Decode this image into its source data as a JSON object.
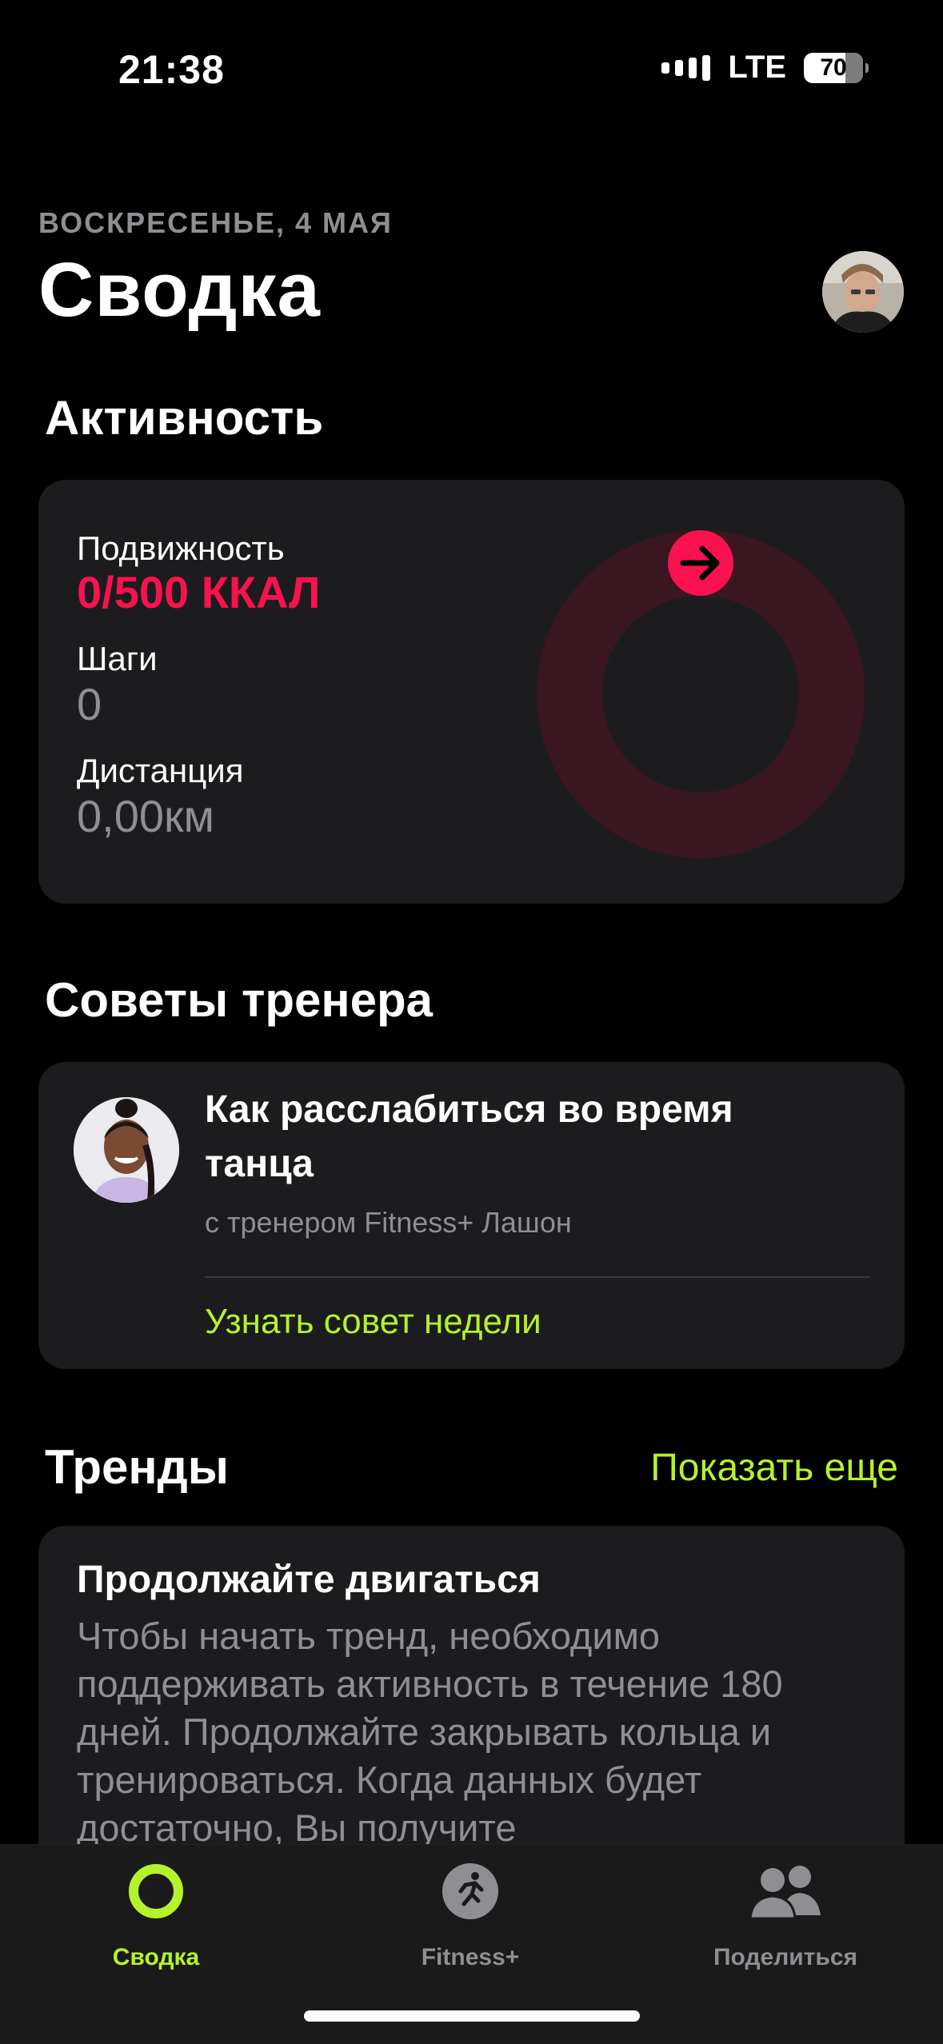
{
  "status_bar": {
    "time": "21:38",
    "network": "LTE",
    "battery": "70"
  },
  "header": {
    "date": "ВОСКРЕСЕНЬЕ, 4 МАЯ",
    "title": "Сводка"
  },
  "activity": {
    "section_title": "Активность",
    "move_label": "Подвижность",
    "move_value": "0/500 ККАЛ",
    "steps_label": "Шаги",
    "steps_value": "0",
    "distance_label": "Дистанция",
    "distance_value": "0,00км",
    "ring_progress": 0,
    "ring_color": "#fa114f",
    "ring_track_color": "#3a1620"
  },
  "coach": {
    "section_title": "Советы тренера",
    "title": "Как расслабиться во время танца",
    "subtitle": "с тренером Fitness+ Лашон",
    "link": "Узнать совет недели"
  },
  "trends": {
    "section_title": "Тренды",
    "show_more": "Показать еще",
    "card_title": "Продолжайте двигаться",
    "card_body": "Чтобы начать тренд, необходимо поддерживать активность в течение 180 дней. Продолжайте закрывать кольца и тренироваться. Когда данных будет достаточно, Вы получите"
  },
  "tabbar": {
    "tabs": [
      {
        "label": "Сводка",
        "icon": "activity-ring-icon",
        "active": true
      },
      {
        "label": "Fitness+",
        "icon": "running-figure-icon",
        "active": false
      },
      {
        "label": "Поделиться",
        "icon": "people-icon",
        "active": false
      }
    ]
  },
  "colors": {
    "accent": "#b4f22c",
    "move": "#fa114f",
    "card": "#1c1c1e",
    "secondary_text": "#8e8e93"
  }
}
